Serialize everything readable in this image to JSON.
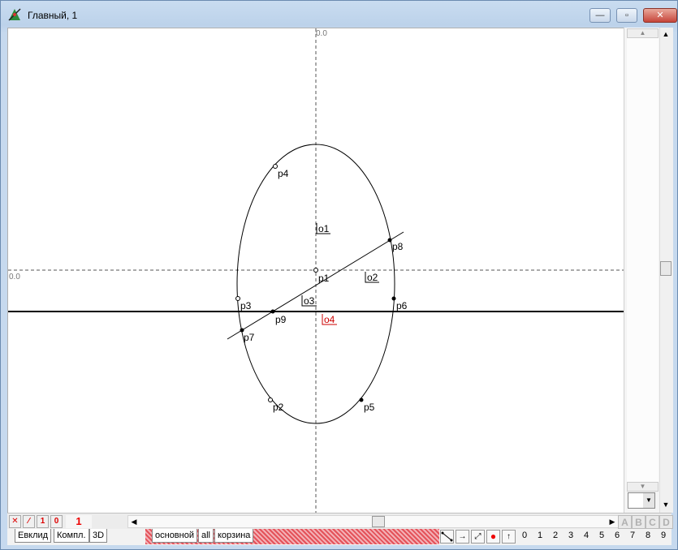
{
  "window": {
    "title": "Главный, 1"
  },
  "controls": {
    "minimize": "—",
    "maximize": "▫",
    "close": "✕"
  },
  "canvas": {
    "axis_label_x": "0.0",
    "axis_label_y": "0.0",
    "labels": {
      "p1": "p1",
      "p2": "p2",
      "p3": "p3",
      "p4": "p4",
      "p5": "p5",
      "p6": "p6",
      "p7": "p7",
      "p8": "p8",
      "p9": "p9",
      "o1": "o1",
      "o2": "o2",
      "o3": "o3",
      "o4": "o4"
    },
    "highlight_color": "#cc0000"
  },
  "bottom_bar": {
    "buttons": [
      "✕",
      "⁄",
      "1",
      "0"
    ],
    "layer_number": "1",
    "abcd": [
      "A",
      "B",
      "C",
      "D"
    ]
  },
  "tabs_left": [
    "Евклид",
    "Компл.",
    "3D"
  ],
  "tabs_middle": [
    "основной",
    "all",
    "корзина"
  ],
  "tool_icons": [
    "segment-tool-icon",
    "arrow-right-tool-icon",
    "diagonal-arrow-tool-icon",
    "red-point-tool-icon",
    "arrow-up-tool-icon"
  ],
  "digits": [
    "0",
    "1",
    "2",
    "3",
    "4",
    "5",
    "6",
    "7",
    "8",
    "9"
  ],
  "colors": {
    "accent_red": "#e00000",
    "hatch": "#e4525a"
  }
}
